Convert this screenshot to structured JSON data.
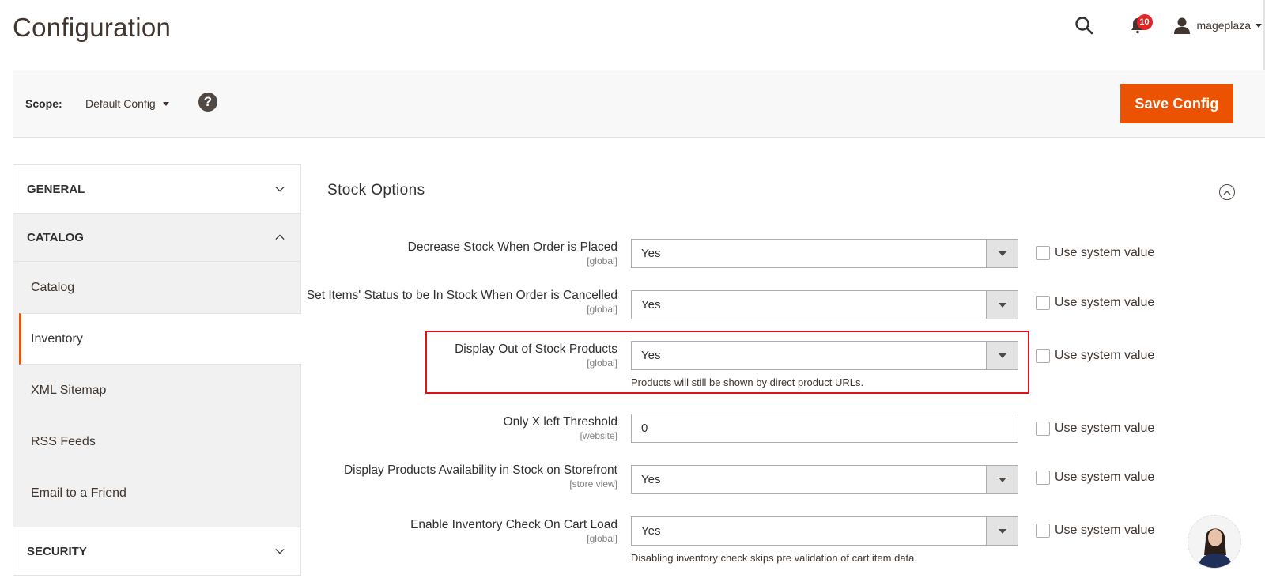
{
  "header": {
    "title": "Configuration",
    "notifications_count": "10",
    "username": "mageplaza"
  },
  "scope": {
    "label": "Scope:",
    "value": "Default Config",
    "help": "?"
  },
  "actions": {
    "save_label": "Save Config"
  },
  "colors": {
    "accent": "#eb5202",
    "badge": "#e22626",
    "highlight": "#e0101a"
  },
  "sidebar": {
    "sections": [
      {
        "label": "GENERAL",
        "expanded": false
      },
      {
        "label": "CATALOG",
        "expanded": true,
        "items": [
          "Catalog",
          "Inventory",
          "XML Sitemap",
          "RSS Feeds",
          "Email to a Friend"
        ],
        "active": "Inventory"
      },
      {
        "label": "SECURITY",
        "expanded": false
      }
    ]
  },
  "main": {
    "section_title": "Stock Options",
    "system_value_label": "Use system value",
    "fields": [
      {
        "label": "Decrease Stock When Order is Placed",
        "scope": "[global]",
        "type": "select",
        "value": "Yes"
      },
      {
        "label": "Set Items' Status to be In Stock When Order is Cancelled",
        "scope": "[global]",
        "type": "select",
        "value": "Yes"
      },
      {
        "label": "Display Out of Stock Products",
        "scope": "[global]",
        "type": "select",
        "value": "Yes",
        "note": "Products will still be shown by direct product URLs.",
        "highlighted": true
      },
      {
        "label": "Only X left Threshold",
        "scope": "[website]",
        "type": "text",
        "value": "0"
      },
      {
        "label": "Display Products Availability in Stock on Storefront",
        "scope": "[store view]",
        "type": "select",
        "value": "Yes"
      },
      {
        "label": "Enable Inventory Check On Cart Load",
        "scope": "[global]",
        "type": "select",
        "value": "Yes",
        "note": "Disabling inventory check skips pre validation of cart item data."
      }
    ]
  }
}
